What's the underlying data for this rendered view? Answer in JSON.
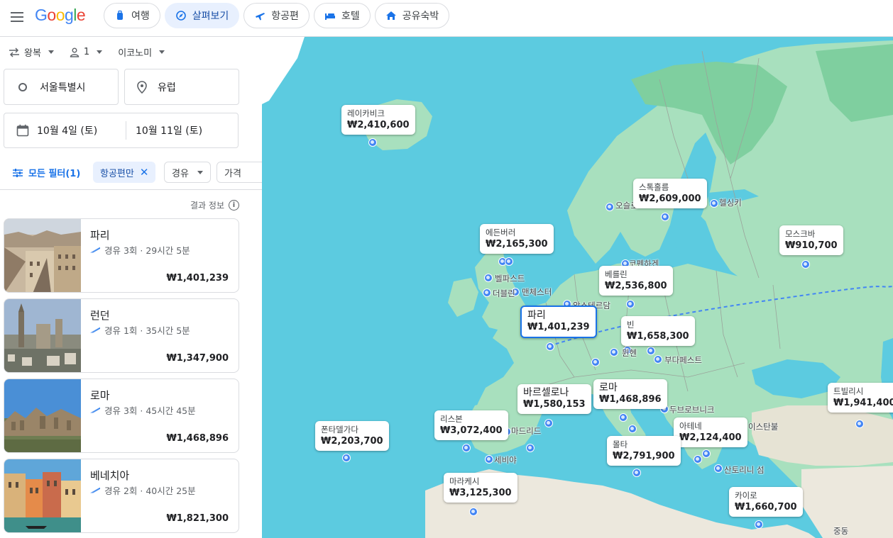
{
  "header": {
    "logo": "Google",
    "tabs": [
      {
        "label": "여행",
        "icon": "luggage-icon",
        "active": false
      },
      {
        "label": "살펴보기",
        "icon": "explore-icon",
        "active": true
      },
      {
        "label": "항공편",
        "icon": "airplane-icon",
        "active": false
      },
      {
        "label": "호텔",
        "icon": "bed-icon",
        "active": false
      },
      {
        "label": "공유숙박",
        "icon": "house-icon",
        "active": false
      }
    ]
  },
  "search": {
    "trip_type": "왕복",
    "passengers": "1",
    "cabin": "이코노미",
    "origin": "서울특별시",
    "destination": "유럽",
    "depart_date": "10월 4일 (토)",
    "return_date": "10월 11일 (토)"
  },
  "filters": {
    "all_filters": "모든 필터(1)",
    "flights_only": "항공편만",
    "stops": "경유",
    "price": "가격"
  },
  "results_info": "결과 정보",
  "results": [
    {
      "city": "파리",
      "meta": "경유 3회 · 29시간 5분",
      "price": "₩1,401,239"
    },
    {
      "city": "런던",
      "meta": "경유 1회 · 35시간 5분",
      "price": "₩1,347,900"
    },
    {
      "city": "로마",
      "meta": "경유 3회 · 45시간 45분",
      "price": "₩1,468,896"
    },
    {
      "city": "베네치아",
      "meta": "경유 2회 · 40시간 25분",
      "price": "₩1,821,300"
    }
  ],
  "map": {
    "price_bubbles": [
      {
        "name": "레이카비크",
        "price": "₩2,410,600"
      },
      {
        "name": "스톡홀름",
        "price": "₩2,609,000"
      },
      {
        "name": "에든버러",
        "price": "₩2,165,300"
      },
      {
        "name": "모스크바",
        "price": "₩910,700"
      },
      {
        "name": "베를린",
        "price": "₩2,536,800"
      },
      {
        "name": "파리",
        "price": "₩1,401,239"
      },
      {
        "name": "빈",
        "price": "₩1,658,300"
      },
      {
        "name": "바르셀로나",
        "price": "₩1,580,153"
      },
      {
        "name": "로마",
        "price": "₩1,468,896"
      },
      {
        "name": "트빌리시",
        "price": "₩1,941,400"
      },
      {
        "name": "리스본",
        "price": "₩3,072,400"
      },
      {
        "name": "폰타델가다",
        "price": "₩2,203,700"
      },
      {
        "name": "아테네",
        "price": "₩2,124,400"
      },
      {
        "name": "몰타",
        "price": "₩2,791,900"
      },
      {
        "name": "마라케시",
        "price": "₩3,125,300"
      },
      {
        "name": "카이로",
        "price": "₩1,660,700"
      }
    ],
    "place_labels": [
      "오슬로",
      "헬싱키",
      "코펜하겐",
      "벨파스트",
      "더블린",
      "맨체스터",
      "암스테르담",
      "뮌헨",
      "부다페스트",
      "마드리드",
      "세비야",
      "두브로브니크",
      "이스탄불",
      "산토리니 섬",
      "중동"
    ],
    "colors": {
      "water": "#5ccbe0",
      "land": "#a8e0be",
      "forest": "#7fcf9f",
      "desert": "#ece8dd",
      "accent": "#1a73e8"
    }
  }
}
